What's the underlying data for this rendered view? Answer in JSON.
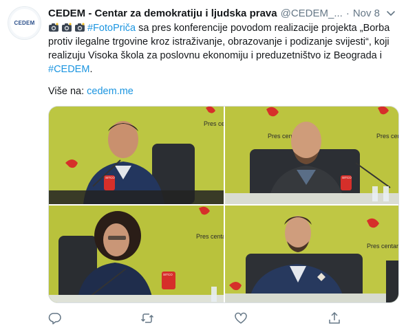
{
  "tweet": {
    "avatar_text": "CEDEM",
    "display_name": "CEDEM - Centar za demokratiju i ljudska prava",
    "handle": "@CEDEM_...",
    "separator": "·",
    "date": "Nov 8",
    "hashtag_foto": "#FotoPriča",
    "text_main": " sa pres konferencije povodom realizacije projekta „Borba protiv ilegalne trgovine kroz istraživanje, obrazovanje i podizanje svijesti“, koji realizuju Visoka škola za poslovnu ekonomiju i preduzetništvo iz Beograda i ",
    "hashtag_cedem": "#CEDEM",
    "text_end": ".",
    "more_label": "Više na: ",
    "more_link": "cedem.me",
    "press_label": "Pres centar",
    "mic_label": "SITCO"
  },
  "icons": {
    "caret": "chevron-down-icon",
    "camera": "camera-emoji-icon",
    "reply": "reply-icon",
    "retweet": "retweet-icon",
    "like": "heart-icon",
    "share": "share-icon"
  },
  "colors": {
    "link": "#1b95e0",
    "muted": "#657786",
    "backdrop": "#b9c43b",
    "brand_red": "#d62f2a"
  }
}
